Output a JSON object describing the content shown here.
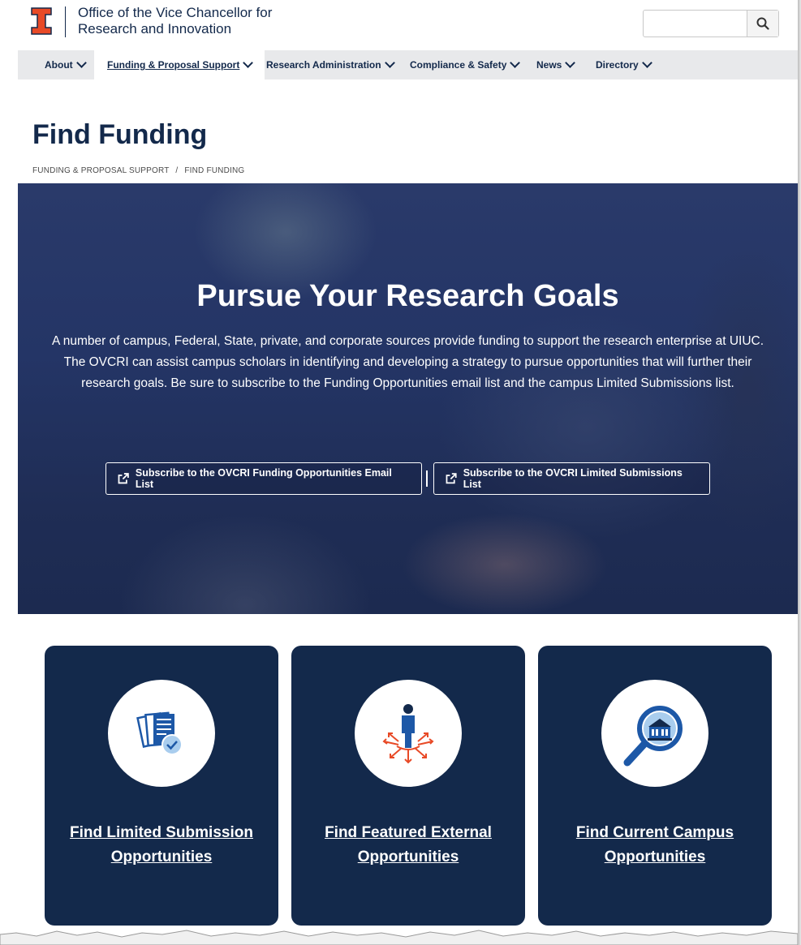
{
  "header": {
    "logo": "block-I-logo",
    "title_line1": "Office of the Vice Chancellor for",
    "title_line2": "Research and Innovation",
    "search_placeholder": "",
    "search_icon": "search-icon"
  },
  "nav": {
    "items": [
      {
        "label": "About"
      },
      {
        "label": "Funding & Proposal Support",
        "active": true
      },
      {
        "label": "Research Administration"
      },
      {
        "label": "Compliance & Safety"
      },
      {
        "label": "News"
      },
      {
        "label": "Directory"
      }
    ]
  },
  "page": {
    "title": "Find Funding",
    "breadcrumb": {
      "parent": "FUNDING & PROPOSAL SUPPORT",
      "separator": "/",
      "current": "FIND FUNDING"
    }
  },
  "hero": {
    "title": "Pursue Your Research Goals",
    "text": "A number of campus, Federal, State, private, and corporate sources provide funding to support the research enterprise at UIUC. The OVCRI can assist campus scholars in identifying and developing a strategy to pursue opportunities that will further their research goals. Be sure to subscribe to the Funding Opportunities email list and the campus Limited Submissions list.",
    "button1": "Subscribe to the OVCRI Funding Opportunities Email List",
    "button2": "Subscribe to the OVCRI Limited Submissions List",
    "separator": "|"
  },
  "cards": [
    {
      "label": "Find Limited Submission Opportunities",
      "icon": "documents-check-icon"
    },
    {
      "label": "Find Featured External Opportunities",
      "icon": "person-arrows-icon"
    },
    {
      "label": "Find Current Campus Opportunities",
      "icon": "magnifier-building-icon"
    }
  ],
  "colors": {
    "navy": "#13294b",
    "orange": "#e84a27",
    "nav_bg": "#e8e9eb",
    "icon_blue": "#1d58a7"
  }
}
